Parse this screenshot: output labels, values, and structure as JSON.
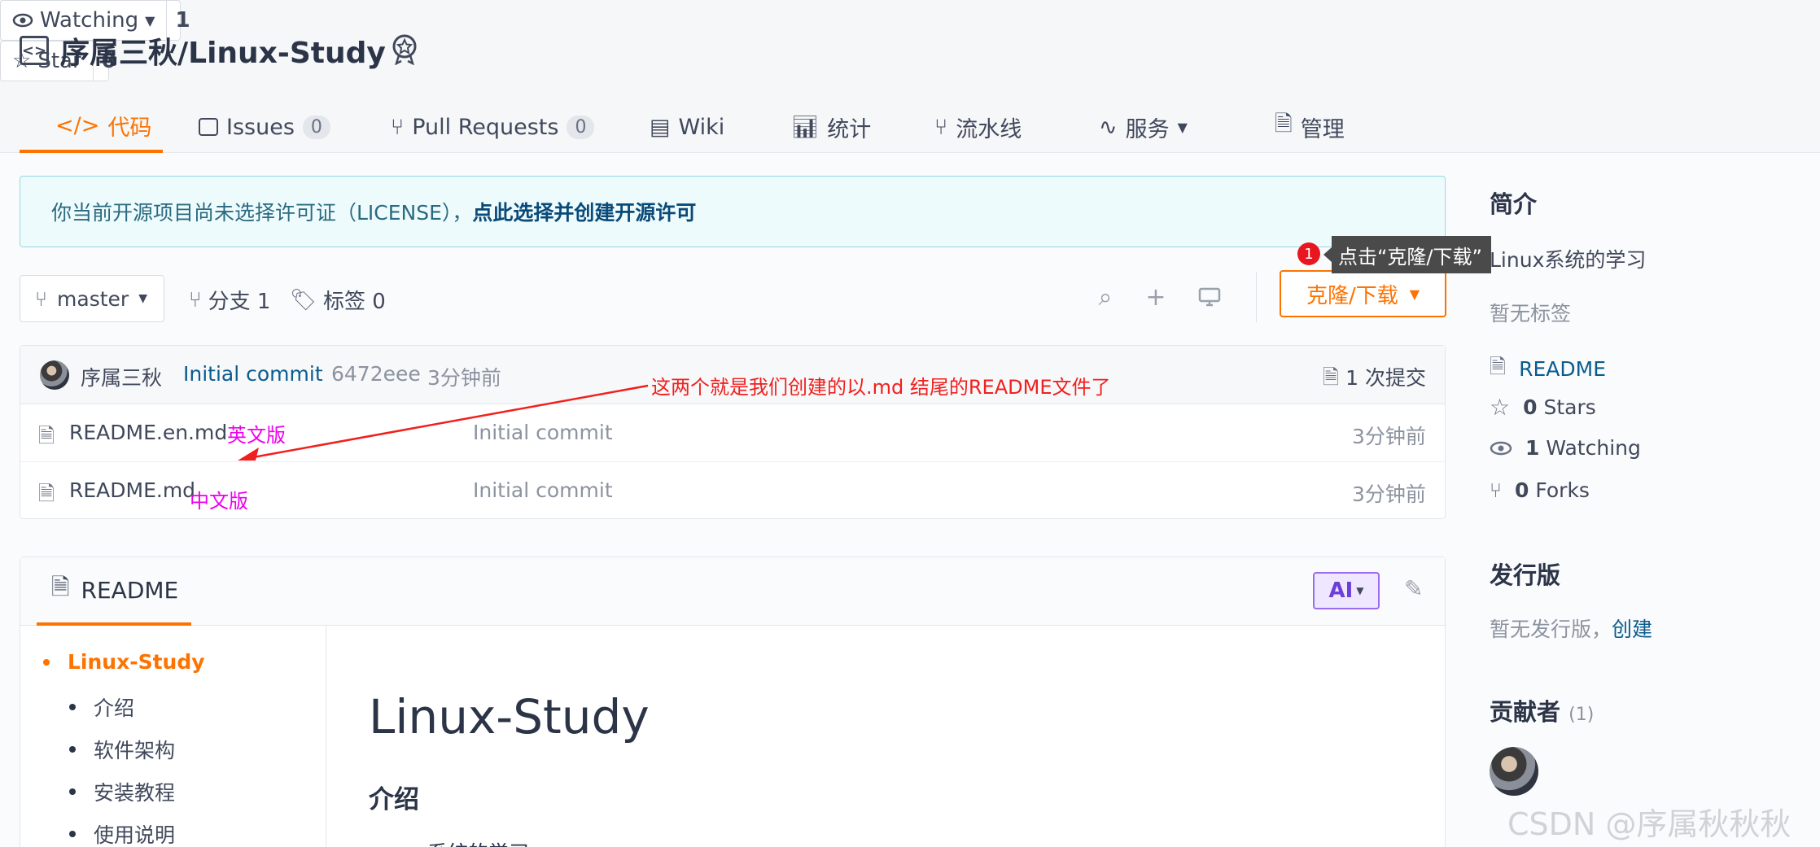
{
  "header": {
    "repo_title": "序属三秋/Linux-Study",
    "watch": {
      "label": "Watching",
      "count": "1"
    },
    "star": {
      "label": "Star",
      "count": "0"
    }
  },
  "tabs": [
    {
      "label": "代码"
    },
    {
      "label": "Issues",
      "count": "0"
    },
    {
      "label": "Pull Requests",
      "count": "0"
    },
    {
      "label": "Wiki"
    },
    {
      "label": "统计"
    },
    {
      "label": "流水线"
    },
    {
      "label": "服务"
    },
    {
      "label": "管理"
    }
  ],
  "license": {
    "text": "你当前开源项目尚未选择许可证（LICENSE），",
    "link": "点此选择并创建开源许可"
  },
  "toolbar": {
    "branch": "master",
    "branches": "分支 1",
    "tags": "标签 0",
    "clone": "克隆/下载"
  },
  "tooltip": {
    "step": "1",
    "text": "点击“克隆/下载”"
  },
  "commit": {
    "author": "序属三秋",
    "message": "Initial commit",
    "hash": "6472eee",
    "time": "3分钟前",
    "count": "1 次提交"
  },
  "files": [
    {
      "name": "README.en.md",
      "message": "Initial commit",
      "time": "3分钟前",
      "note": "英文版"
    },
    {
      "name": "README.md",
      "message": "Initial commit",
      "time": "3分钟前",
      "note": "中文版"
    }
  ],
  "annotation": "这两个就是我们创建的以.md 结尾的README文件了",
  "readme": {
    "tab": "README",
    "ai": "AI",
    "toc": [
      "Linux-Study",
      "介绍",
      "软件架构",
      "安装教程",
      "使用说明"
    ],
    "h1": "Linux-Study",
    "h2": "介绍",
    "partial_text": "系统的学习"
  },
  "sidebar": {
    "intro_title": "简介",
    "intro_text": "Linux系统的学习",
    "no_tags": "暂无标签",
    "readme": "README",
    "stars_n": "0",
    "stars": "Stars",
    "watching_n": "1",
    "watching": "Watching",
    "forks_n": "0",
    "forks": "Forks",
    "release_title": "发行版",
    "release_text": "暂无发行版，",
    "release_link": "创建",
    "contrib_title": "贡献者",
    "contrib_count": "(1)"
  },
  "watermark": "CSDN @序属秋秋秋",
  "colors": {
    "accent": "#fe7300",
    "link": "#0a5c8f",
    "annotation_red": "#f0201e",
    "annotation_pink": "#ee00ee"
  }
}
